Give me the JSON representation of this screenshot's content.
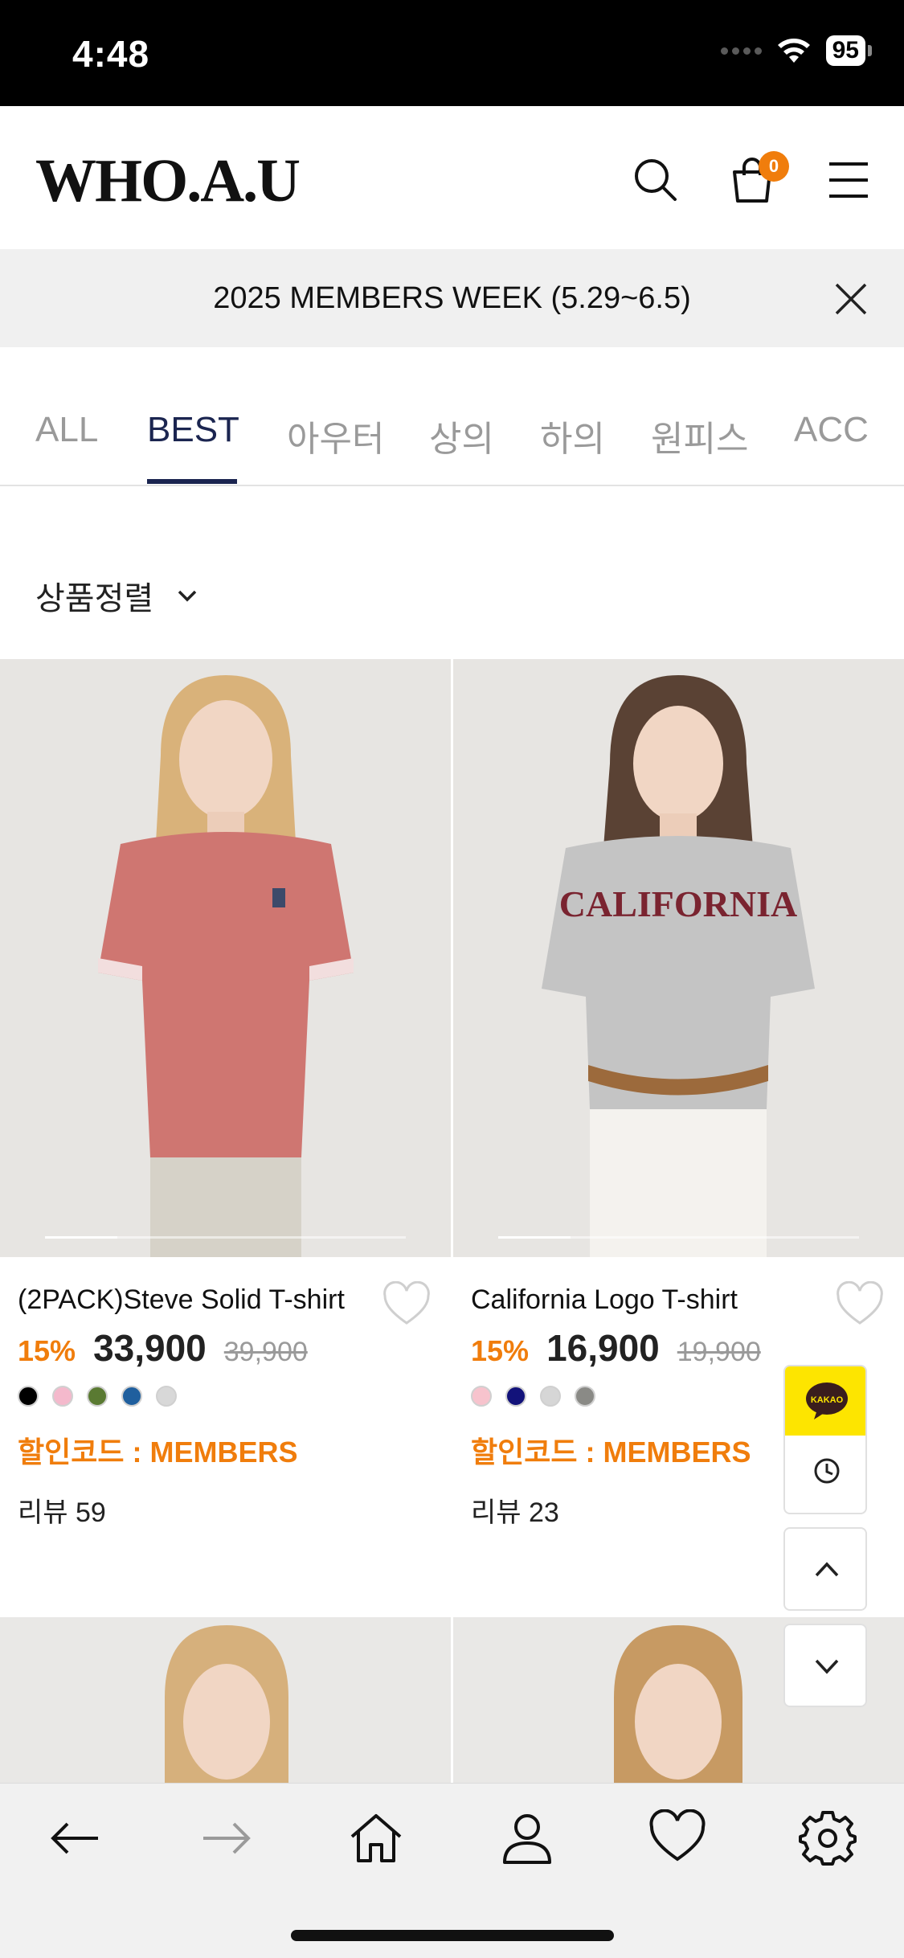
{
  "status_bar": {
    "time": "4:48",
    "battery": "95"
  },
  "header": {
    "logo": "WHO.A.U",
    "cart_count": "0"
  },
  "banner": {
    "text": "2025 MEMBERS WEEK (5.29~6.5)"
  },
  "tabs": [
    {
      "label": "ALL",
      "active": false
    },
    {
      "label": "BEST",
      "active": true
    },
    {
      "label": "아우터",
      "active": false
    },
    {
      "label": "상의",
      "active": false
    },
    {
      "label": "하의",
      "active": false
    },
    {
      "label": "원피스",
      "active": false
    },
    {
      "label": "ACC",
      "active": false
    }
  ],
  "sort": {
    "label": "상품정렬"
  },
  "products": [
    {
      "name": "(2PACK)Steve Solid T-shirt",
      "discount": "15%",
      "price": "33,900",
      "original_price": "39,900",
      "swatches": [
        "#000000",
        "#f4b9cc",
        "#5a7a32",
        "#1f5f9e",
        "#d8d8d8"
      ],
      "code": "할인코드 : MEMBERS",
      "review": "리뷰 59"
    },
    {
      "name": "California Logo T-shirt",
      "discount": "15%",
      "price": "16,900",
      "original_price": "19,900",
      "swatches": [
        "#f7c3cd",
        "#12127a",
        "#d6d6d6",
        "#8a8a86"
      ],
      "code": "할인코드 : MEMBERS",
      "review": "리뷰 23"
    }
  ],
  "floating": {
    "kakao_label": "KAKAO"
  },
  "colors": {
    "accent": "#f07d0c",
    "active_tab": "#1b2550",
    "kakao": "#fde500"
  }
}
